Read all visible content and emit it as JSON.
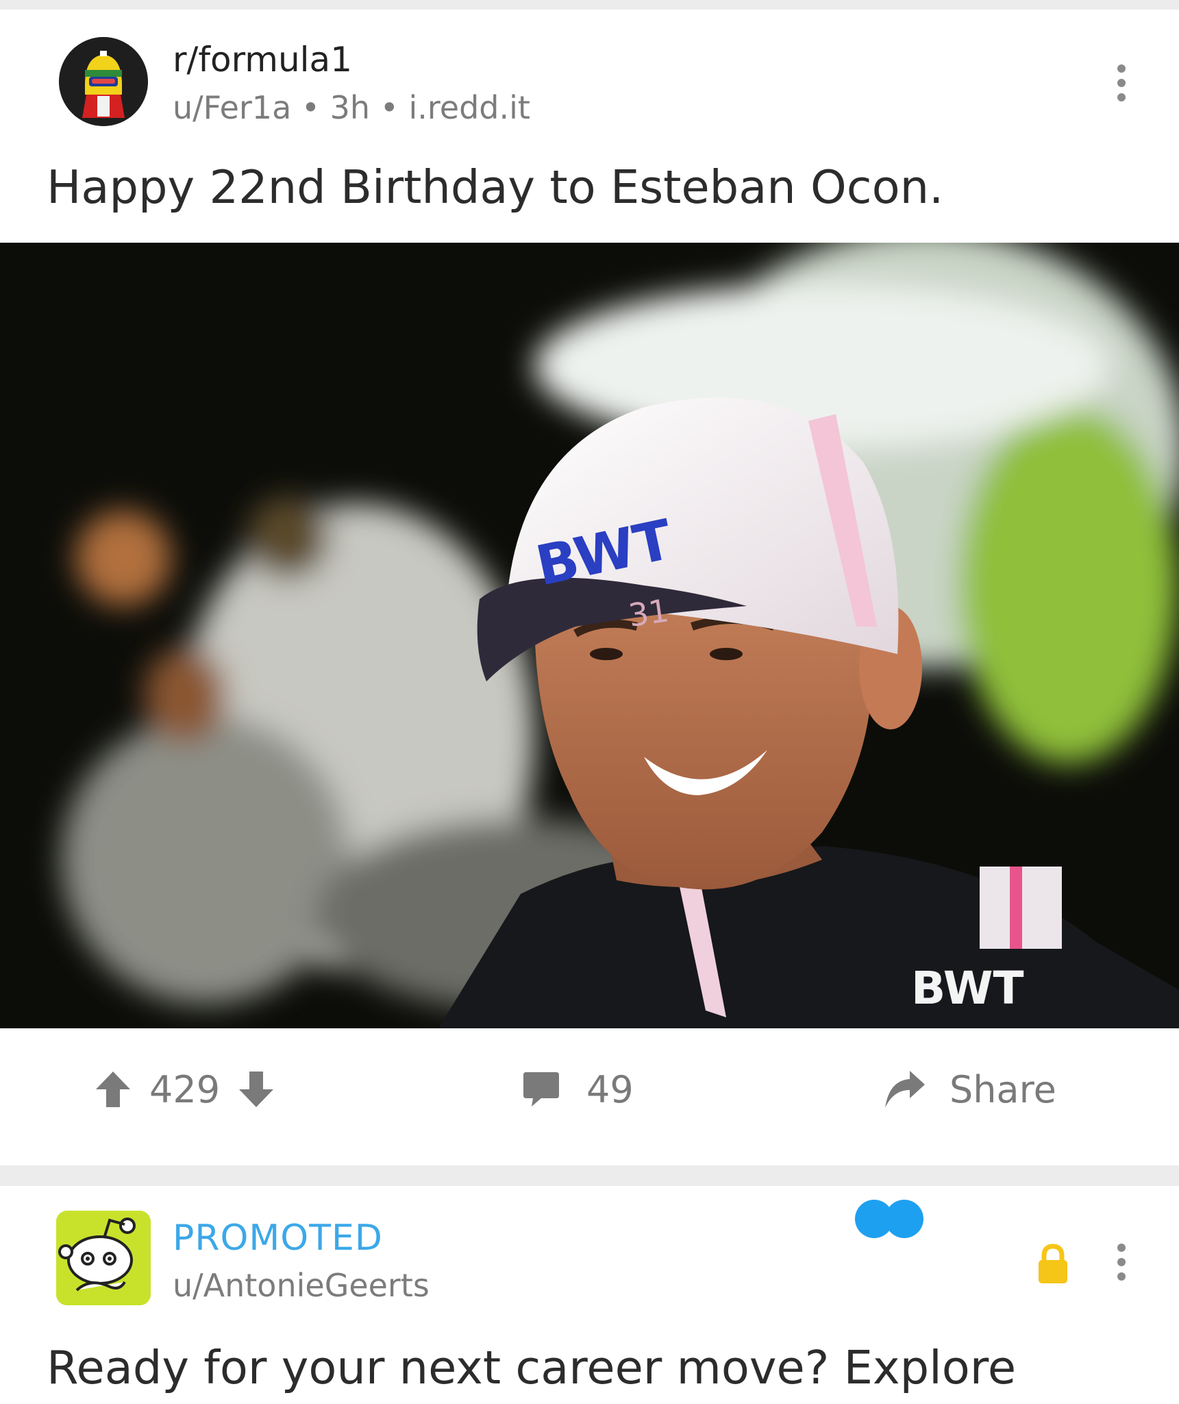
{
  "post": {
    "subreddit": "r/formula1",
    "author": "u/Fer1a",
    "age": "3h",
    "domain": "i.redd.it",
    "meta_separator": " • ",
    "title": "Happy 22nd Birthday to Esteban Ocon.",
    "image": {
      "cap_logo": "BWT",
      "cap_number": "31",
      "shirt_logo": "BWT"
    },
    "upvotes": "429",
    "comments": "49",
    "share_label": "Share"
  },
  "promo": {
    "label": "PROMOTED",
    "author": "u/AntonieGeerts",
    "title": "Ready for your next career move? Explore"
  },
  "colors": {
    "promoted_blue": "#3ca8e8",
    "promo_avatar_green": "#c8e22c",
    "lock_yellow": "#f5c518",
    "divider": "#ececec"
  },
  "icons": {
    "upvote": "arrow-up-icon",
    "downvote": "arrow-down-icon",
    "comment": "comment-bubble-icon",
    "share": "share-arrow-icon",
    "more": "more-vertical-icon",
    "lock": "lock-icon"
  }
}
